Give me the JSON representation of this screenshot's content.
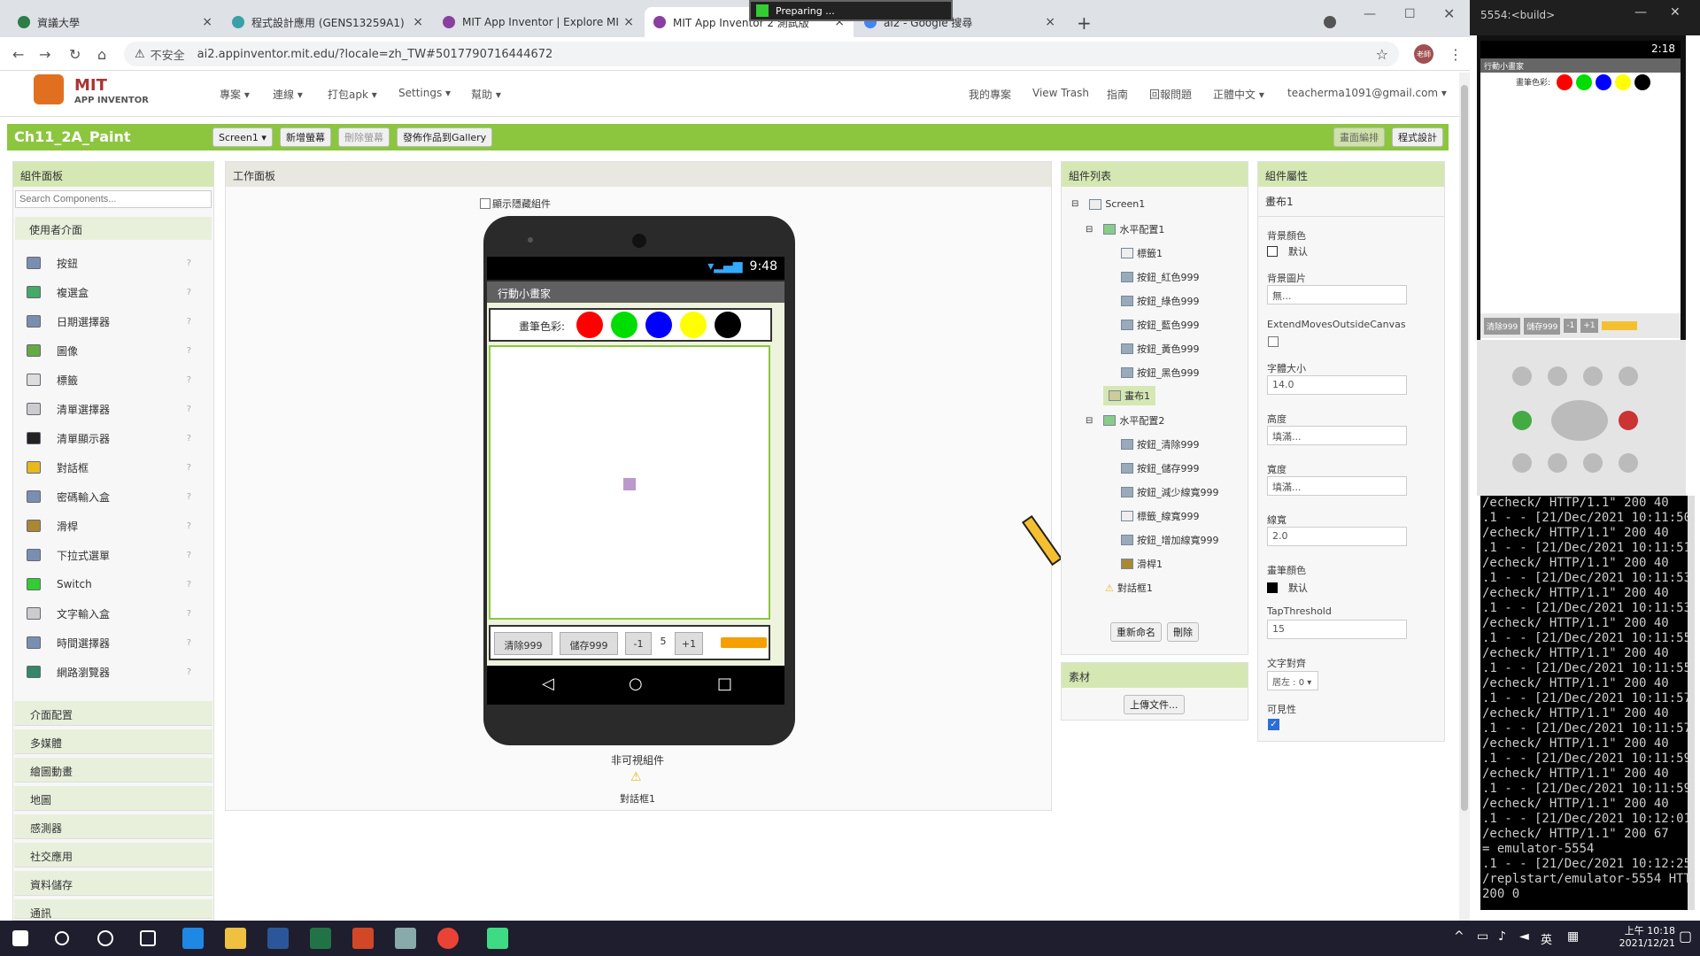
{
  "browser": {
    "tabs": [
      {
        "title": "資議大學"
      },
      {
        "title": "程式設計應用 (GENS13259A1)"
      },
      {
        "title": "MIT App Inventor | Explore MIT"
      },
      {
        "title": "MIT App Inventor 2 測試版"
      },
      {
        "title": "ai2 - Google 搜尋"
      }
    ],
    "insecure_label": "不安全",
    "url": "ai2.appinventor.mit.edu/?locale=zh_TW#5017790716444672",
    "preparing": "Preparing ...",
    "avatar_text": "老師"
  },
  "topnav": {
    "logo_text1": "MIT",
    "logo_text2": "APP INVENTOR",
    "menu": [
      "專案 ▾",
      "連線 ▾",
      "打包apk ▾",
      "Settings ▾",
      "幫助 ▾"
    ],
    "right": [
      "我的專案",
      "View Trash",
      "指南",
      "回報問題",
      "正體中文 ▾",
      "teacherma1091@gmail.com ▾"
    ]
  },
  "toolbar": {
    "project_name": "Ch11_2A_Paint",
    "screen_select": "Screen1 ▾",
    "add_screen": "新增螢幕",
    "remove_screen": "刪除螢幕",
    "publish": "發佈作品到Gallery",
    "designer": "畫面編排",
    "blocks": "程式設計"
  },
  "palette": {
    "header": "組件面板",
    "search_placeholder": "Search Components...",
    "user_interface": "使用者介面",
    "items": [
      "按鈕",
      "複選盒",
      "日期選擇器",
      "圖像",
      "標籤",
      "清單選擇器",
      "清單顯示器",
      "對話框",
      "密碼輸入盒",
      "滑桿",
      "下拉式選單",
      "Switch",
      "文字輸入盒",
      "時間選擇器",
      "網路瀏覽器"
    ],
    "categories": [
      "介面配置",
      "多媒體",
      "繪圖動畫",
      "地圖",
      "感測器",
      "社交應用",
      "資料儲存",
      "通訊"
    ]
  },
  "viewer": {
    "header": "工作面板",
    "show_hidden": "顯示隱藏組件",
    "status_time": "9:48",
    "app_title": "行動小畫家",
    "paint_color_label": "畫筆色彩:",
    "colors": [
      "#ff0000",
      "#00dd00",
      "#0000ff",
      "#ffff00",
      "#000000"
    ],
    "clear_btn": "清除999",
    "save_btn": "儲存999",
    "minus_btn": "-1",
    "width_value": "5",
    "plus_btn": "+1",
    "nonvisible_label": "非可視組件",
    "notifier_label": "對話框1"
  },
  "components": {
    "header": "組件列表",
    "tree": [
      {
        "label": "Screen1"
      },
      {
        "label": "水平配置1"
      },
      {
        "label": "標籤1"
      },
      {
        "label": "按鈕_紅色999"
      },
      {
        "label": "按鈕_綠色999"
      },
      {
        "label": "按鈕_藍色999"
      },
      {
        "label": "按鈕_黃色999"
      },
      {
        "label": "按鈕_黑色999"
      },
      {
        "label": "畫布1"
      },
      {
        "label": "水平配置2"
      },
      {
        "label": "按鈕_清除999"
      },
      {
        "label": "按鈕_儲存999"
      },
      {
        "label": "按鈕_減少線寬999"
      },
      {
        "label": "標籤_線寬999"
      },
      {
        "label": "按鈕_增加線寬999"
      },
      {
        "label": "滑桿1"
      },
      {
        "label": "對話框1"
      }
    ],
    "rename_btn": "重新命名",
    "delete_btn": "刪除",
    "media_header": "素材",
    "upload_btn": "上傳文件..."
  },
  "properties": {
    "header": "組件屬性",
    "component": "畫布1",
    "bg_color_label": "背景顏色",
    "bg_color_value": "默认",
    "bg_image_label": "背景圖片",
    "bg_image_value": "無...",
    "extend_label": "ExtendMovesOutsideCanvas",
    "font_size_label": "字體大小",
    "font_size_value": "14.0",
    "height_label": "高度",
    "height_value": "填滿...",
    "width_label": "寬度",
    "width_value": "填滿...",
    "line_width_label": "線寬",
    "line_width_value": "2.0",
    "paint_color_label": "畫筆顏色",
    "paint_color_value": "默认",
    "tap_label": "TapThreshold",
    "tap_value": "15",
    "align_label": "文字對齊",
    "align_value": "居左 : 0 ▾",
    "visible_label": "可見性"
  },
  "emulator": {
    "title": "5554:<build>",
    "status_time": "2:18",
    "app_title": "行動小畫家",
    "paint_label": "畫筆色彩:",
    "buttons": [
      "清除999",
      "儲存999",
      "-1",
      "+1"
    ],
    "console_lines": [
      "/echeck/ HTTP/1.1\" 200 40",
      ".1 - - [21/Dec/2021 10:11:50",
      "/echeck/ HTTP/1.1\" 200 40",
      ".1 - - [21/Dec/2021 10:11:51",
      "/echeck/ HTTP/1.1\" 200 40",
      ".1 - - [21/Dec/2021 10:11:53",
      "/echeck/ HTTP/1.1\" 200 40",
      ".1 - - [21/Dec/2021 10:11:53",
      "/echeck/ HTTP/1.1\" 200 40",
      ".1 - - [21/Dec/2021 10:11:55",
      "/echeck/ HTTP/1.1\" 200 40",
      ".1 - - [21/Dec/2021 10:11:55",
      "/echeck/ HTTP/1.1\" 200 40",
      ".1 - - [21/Dec/2021 10:11:57",
      "/echeck/ HTTP/1.1\" 200 40",
      ".1 - - [21/Dec/2021 10:11:57",
      "/echeck/ HTTP/1.1\" 200 40",
      ".1 - - [21/Dec/2021 10:11:59",
      "/echeck/ HTTP/1.1\" 200 40",
      ".1 - - [21/Dec/2021 10:11:59",
      "/echeck/ HTTP/1.1\" 200 40",
      ".1 - - [21/Dec/2021 10:12:01",
      "/echeck/ HTTP/1.1\" 200 67",
      "= emulator-5554",
      ".1 - - [21/Dec/2021 10:12:25",
      "/replstart/emulator-5554 HTT",
      "200 0"
    ]
  },
  "taskbar": {
    "ime": "英",
    "time": "上午 10:18",
    "date": "2021/12/21"
  }
}
